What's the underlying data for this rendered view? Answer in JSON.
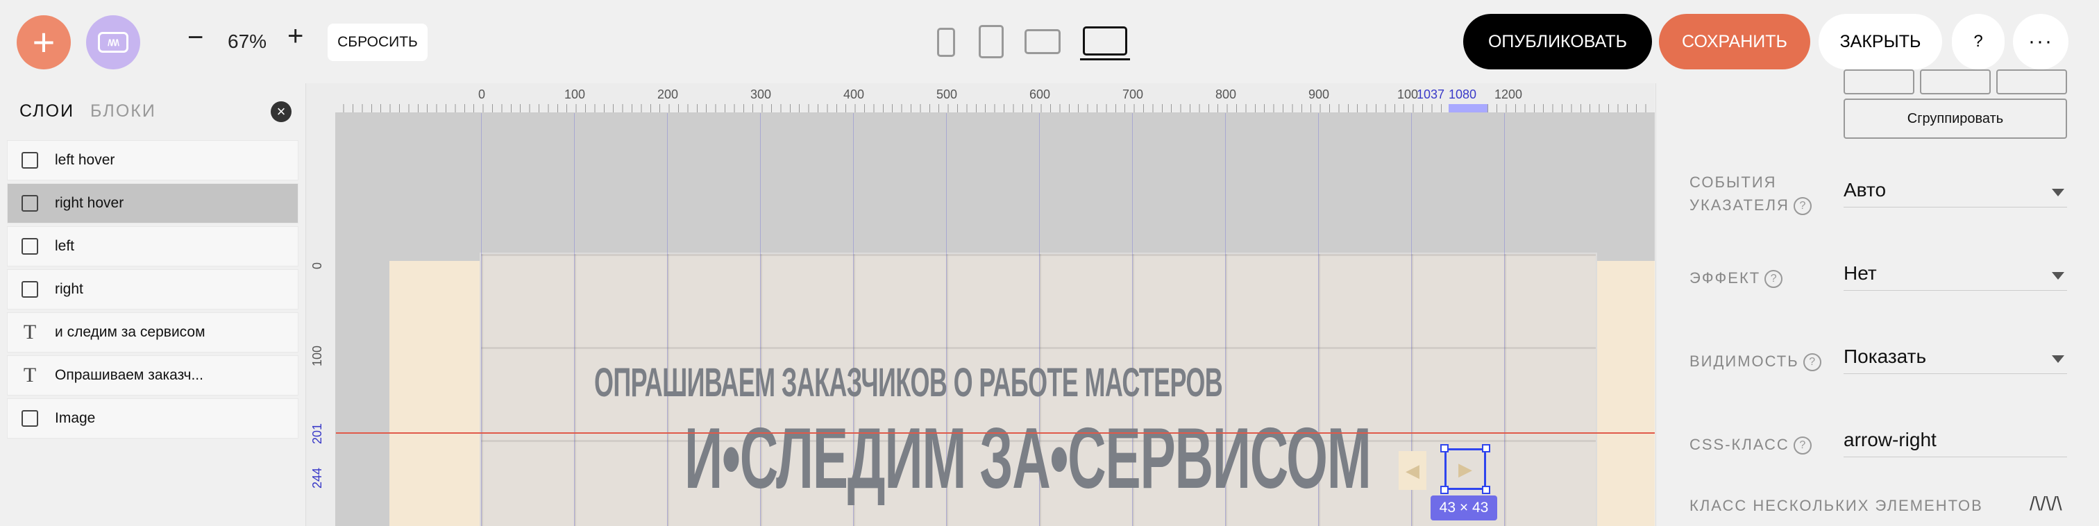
{
  "toolbar": {
    "add_label": "+",
    "logo_text": "/\\/\\/\\",
    "zoom_minus": "−",
    "zoom_value": "67%",
    "zoom_plus": "+",
    "reset_label": "СБРОСИТЬ",
    "devices": [
      "phone-icon",
      "tablet-icon",
      "tablet-landscape-icon",
      "laptop-icon"
    ],
    "active_device": "laptop-icon",
    "publish_label": "ОПУБЛИКОВАТЬ",
    "save_label": "СОХРАНИТЬ",
    "close_label": "ЗАКРЫТЬ",
    "help_label": "?",
    "more_label": "···"
  },
  "left_panel": {
    "tabs": [
      "СЛОИ",
      "БЛОКИ"
    ],
    "active_tab": "СЛОИ",
    "close_label": "×",
    "layers": [
      {
        "label": "left hover",
        "type": "shape"
      },
      {
        "label": "right hover",
        "type": "shape",
        "selected": true
      },
      {
        "label": "left",
        "type": "shape"
      },
      {
        "label": "right",
        "type": "shape"
      },
      {
        "label": "и следим за сервисом",
        "type": "text"
      },
      {
        "label": "Опрашиваем заказч...",
        "type": "text"
      },
      {
        "label": "Image",
        "type": "shape"
      }
    ]
  },
  "canvas": {
    "ruler_x": [
      "0",
      "100",
      "200",
      "300",
      "400",
      "500",
      "600",
      "700",
      "800",
      "900",
      "100",
      "1037",
      "1080",
      "1200"
    ],
    "ruler_y": [
      "0",
      "100",
      "201",
      "244"
    ],
    "headline_small": "ОПРАШИВАЕМ ЗАКАЗЧИКОВ О РАБОТЕ МАСТЕРОВ",
    "headline_big": "И•СЛЕДИМ ЗА•СЕРВИСОМ",
    "arrow_left": "◀",
    "arrow_right": "▶",
    "size_badge": "43 × 43"
  },
  "right_panel": {
    "group_label": "Сгруппировать",
    "props": [
      {
        "label_line1": "СОБЫТИЯ",
        "label_line2": "УКАЗАТЕЛЯ",
        "value": "Авто",
        "has_help": true,
        "dropdown": true
      },
      {
        "label_line1": "ЭФФЕКТ",
        "label_line2": "",
        "value": "Нет",
        "has_help": true,
        "dropdown": true
      },
      {
        "label_line1": "ВИДИМОСТЬ",
        "label_line2": "",
        "value": "Показать",
        "has_help": true,
        "dropdown": true
      },
      {
        "label_line1": "CSS-КЛАСС",
        "label_line2": "",
        "value": "arrow-right",
        "has_help": true,
        "dropdown": false
      }
    ],
    "multi_class_label": "КЛАСС НЕСКОЛЬКИХ ЭЛЕМЕНТОВ",
    "multi_class_icon": "/\\/\\/\\",
    "help_glyph": "?"
  }
}
